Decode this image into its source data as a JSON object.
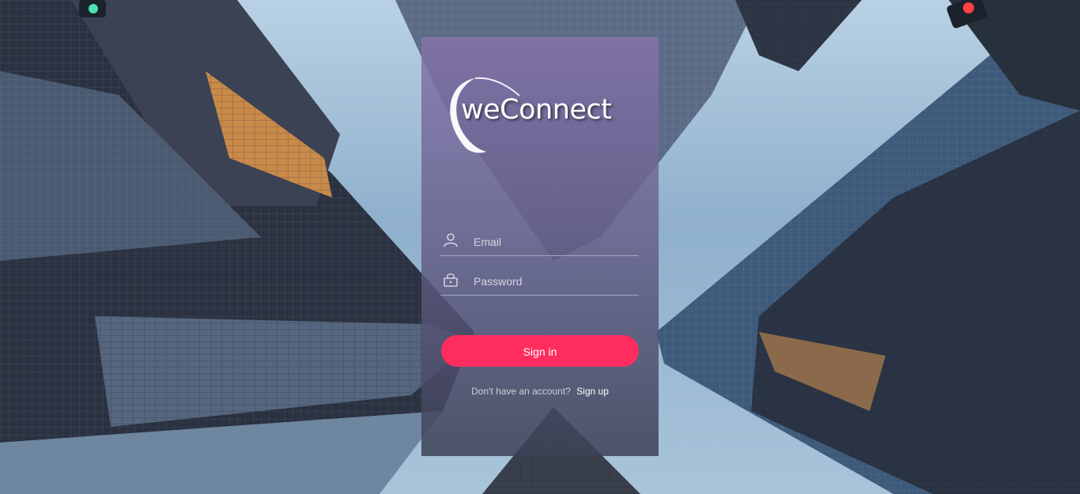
{
  "app": {
    "logo_text": "weConnect"
  },
  "login": {
    "email": {
      "placeholder": "Email",
      "icon": "user-icon"
    },
    "password": {
      "placeholder": "Password",
      "icon": "lock-icon"
    },
    "signin_label": "Sign in",
    "signup_prompt": "Don't have an account?",
    "signup_link": "Sign up"
  },
  "colors": {
    "accent": "#ff2d5f",
    "card_top": "#8473aa",
    "card_bottom": "#3c4256"
  }
}
